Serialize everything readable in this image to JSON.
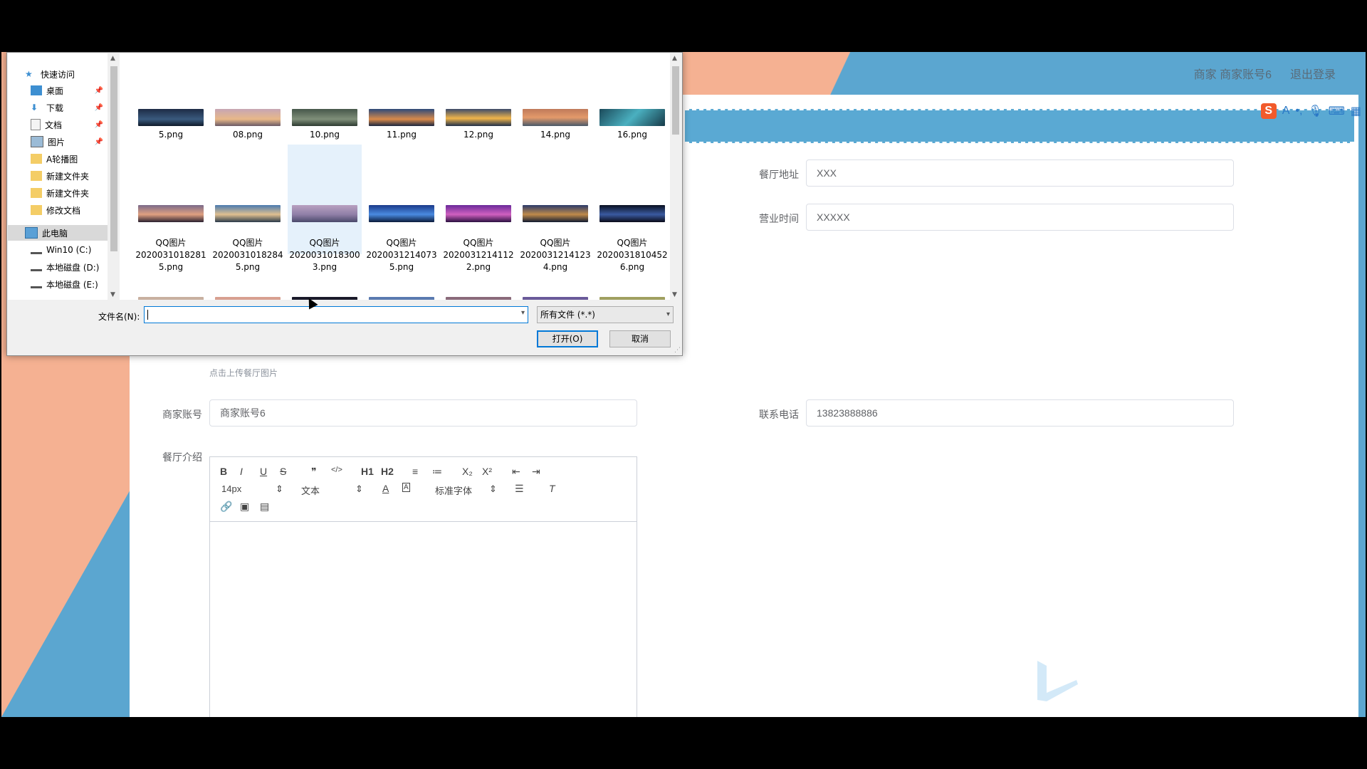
{
  "header": {
    "user_text": "商家 商家账号6",
    "logout": "退出登录"
  },
  "form": {
    "address_label": "餐厅地址",
    "address_value": "XXX",
    "hours_label": "营业时间",
    "hours_value": "XXXXX",
    "upload_hint": "点击上传餐厅图片",
    "account_label": "商家账号",
    "account_value": "商家账号6",
    "phone_label": "联系电话",
    "phone_value": "13823888886",
    "intro_label": "餐厅介绍"
  },
  "editor": {
    "font_size": "14px",
    "text_type": "文本",
    "font_family": "标准字体",
    "buttons": [
      "B",
      "I",
      "U",
      "S",
      "❞",
      "</>",
      "H1",
      "H2",
      "≡",
      "≔",
      "X₂",
      "X²",
      "⇤",
      "⇥"
    ]
  },
  "dialog": {
    "nav": [
      {
        "label": "快速访问",
        "icon": "star-icon"
      },
      {
        "label": "桌面",
        "icon": "desktop-icon",
        "pinned": true
      },
      {
        "label": "下载",
        "icon": "download-icon",
        "pinned": true
      },
      {
        "label": "文档",
        "icon": "document-icon",
        "pinned": true
      },
      {
        "label": "图片",
        "icon": "picture-icon",
        "pinned": true
      },
      {
        "label": "A轮播图",
        "icon": "folder-icon"
      },
      {
        "label": "新建文件夹",
        "icon": "folder-icon"
      },
      {
        "label": "新建文件夹",
        "icon": "folder-icon"
      },
      {
        "label": "修改文档",
        "icon": "folder-icon"
      },
      {
        "label": "此电脑",
        "icon": "computer-icon"
      },
      {
        "label": "Win10 (C:)",
        "icon": "drive-icon"
      },
      {
        "label": "本地磁盘 (D:)",
        "icon": "drive-icon"
      },
      {
        "label": "本地磁盘 (E:)",
        "icon": "drive-icon"
      }
    ],
    "files_row1": [
      "5.png",
      "08.png",
      "10.png",
      "11.png",
      "12.png",
      "14.png",
      "16.png"
    ],
    "files_row2": [
      "QQ图片\n2020031018281\n5.png",
      "QQ图片\n2020031018284\n5.png",
      "QQ图片\n2020031018300\n3.png",
      "QQ图片\n2020031214073\n5.png",
      "QQ图片\n2020031214112\n2.png",
      "QQ图片\n2020031214123\n4.png",
      "QQ图片\n2020031810452\n6.png"
    ],
    "filename_label": "文件名(N):",
    "filetype": "所有文件 (*.*)",
    "open_button": "打开(O)",
    "cancel_button": "取消"
  },
  "colors": {
    "salmon": "#f5b192",
    "blue": "#5ba6d0"
  }
}
